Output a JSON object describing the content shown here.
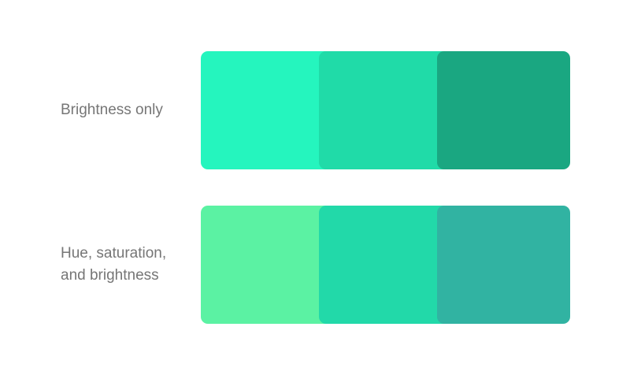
{
  "rows": [
    {
      "label": "Brightness only",
      "swatches": [
        "#25F5BE",
        "#20DBA8",
        "#1AA781"
      ]
    },
    {
      "label": "Hue, saturation,\nand brightness",
      "swatches": [
        "#5BF2A3",
        "#22D9A9",
        "#31B3A2"
      ]
    }
  ]
}
